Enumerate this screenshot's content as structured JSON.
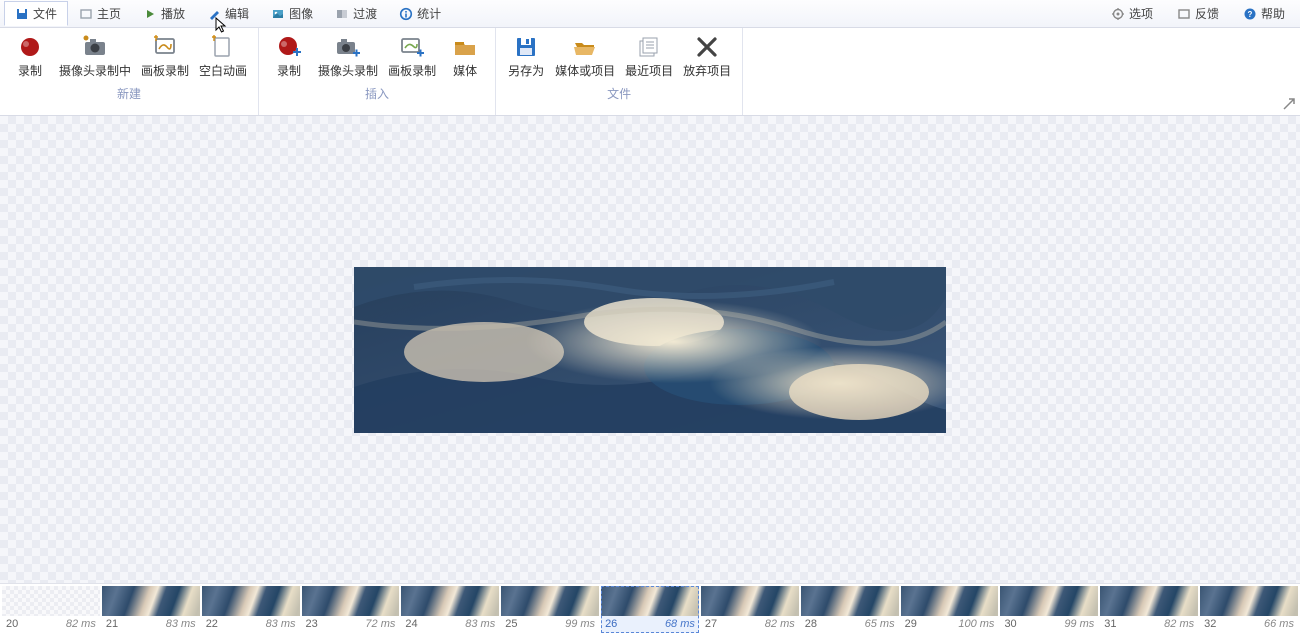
{
  "menu": {
    "items": [
      {
        "label": "文件",
        "iconColor": "#2a72c4"
      },
      {
        "label": "主页",
        "iconColor": "#9aa2ad"
      },
      {
        "label": "播放",
        "iconColor": "#4a8a3a"
      },
      {
        "label": "编辑",
        "iconColor": "#2a72c4"
      },
      {
        "label": "图像",
        "iconColor": "#4aa0c8"
      },
      {
        "label": "过渡",
        "iconColor": "#9aa2ad"
      },
      {
        "label": "统计",
        "iconColor": "#2a72c4"
      }
    ],
    "right": [
      {
        "label": "选项",
        "iconColor": "#888"
      },
      {
        "label": "反馈",
        "iconColor": "#888"
      },
      {
        "label": "帮助",
        "iconColor": "#2a72c4"
      }
    ]
  },
  "ribbon": {
    "groups": [
      {
        "title": "新建",
        "buttons": [
          {
            "name": "record",
            "label": "录制",
            "icon": "rec"
          },
          {
            "name": "webcam-record",
            "label": "摄像头录制中",
            "icon": "cam"
          },
          {
            "name": "board-record",
            "label": "画板录制",
            "icon": "board-new"
          },
          {
            "name": "blank-anim",
            "label": "空白动画",
            "icon": "blank-new"
          }
        ]
      },
      {
        "title": "插入",
        "buttons": [
          {
            "name": "insert-record",
            "label": "录制",
            "icon": "rec-plus"
          },
          {
            "name": "insert-webcam",
            "label": "摄像头录制",
            "icon": "cam-plus"
          },
          {
            "name": "insert-board",
            "label": "画板录制",
            "icon": "board-plus"
          },
          {
            "name": "insert-media",
            "label": "媒体",
            "icon": "folder"
          }
        ]
      },
      {
        "title": "文件",
        "buttons": [
          {
            "name": "save-as",
            "label": "另存为",
            "icon": "save"
          },
          {
            "name": "media-proj",
            "label": "媒体或项目",
            "icon": "folder-open"
          },
          {
            "name": "recent",
            "label": "最近项目",
            "icon": "doc-stack"
          },
          {
            "name": "discard",
            "label": "放弃项目",
            "icon": "close"
          }
        ]
      }
    ]
  },
  "timeline": {
    "frames": [
      {
        "num": 20,
        "ms": "82 ms",
        "blank": true,
        "selected": false
      },
      {
        "num": 21,
        "ms": "83 ms",
        "blank": false,
        "selected": false
      },
      {
        "num": 22,
        "ms": "83 ms",
        "blank": false,
        "selected": false
      },
      {
        "num": 23,
        "ms": "72 ms",
        "blank": false,
        "selected": false
      },
      {
        "num": 24,
        "ms": "83 ms",
        "blank": false,
        "selected": false
      },
      {
        "num": 25,
        "ms": "99 ms",
        "blank": false,
        "selected": false
      },
      {
        "num": 26,
        "ms": "68 ms",
        "blank": false,
        "selected": true
      },
      {
        "num": 27,
        "ms": "82 ms",
        "blank": false,
        "selected": false
      },
      {
        "num": 28,
        "ms": "65 ms",
        "blank": false,
        "selected": false
      },
      {
        "num": 29,
        "ms": "100 ms",
        "blank": false,
        "selected": false
      },
      {
        "num": 30,
        "ms": "99 ms",
        "blank": false,
        "selected": false
      },
      {
        "num": 31,
        "ms": "82 ms",
        "blank": false,
        "selected": false
      },
      {
        "num": 32,
        "ms": "66 ms",
        "blank": false,
        "selected": false
      }
    ]
  }
}
